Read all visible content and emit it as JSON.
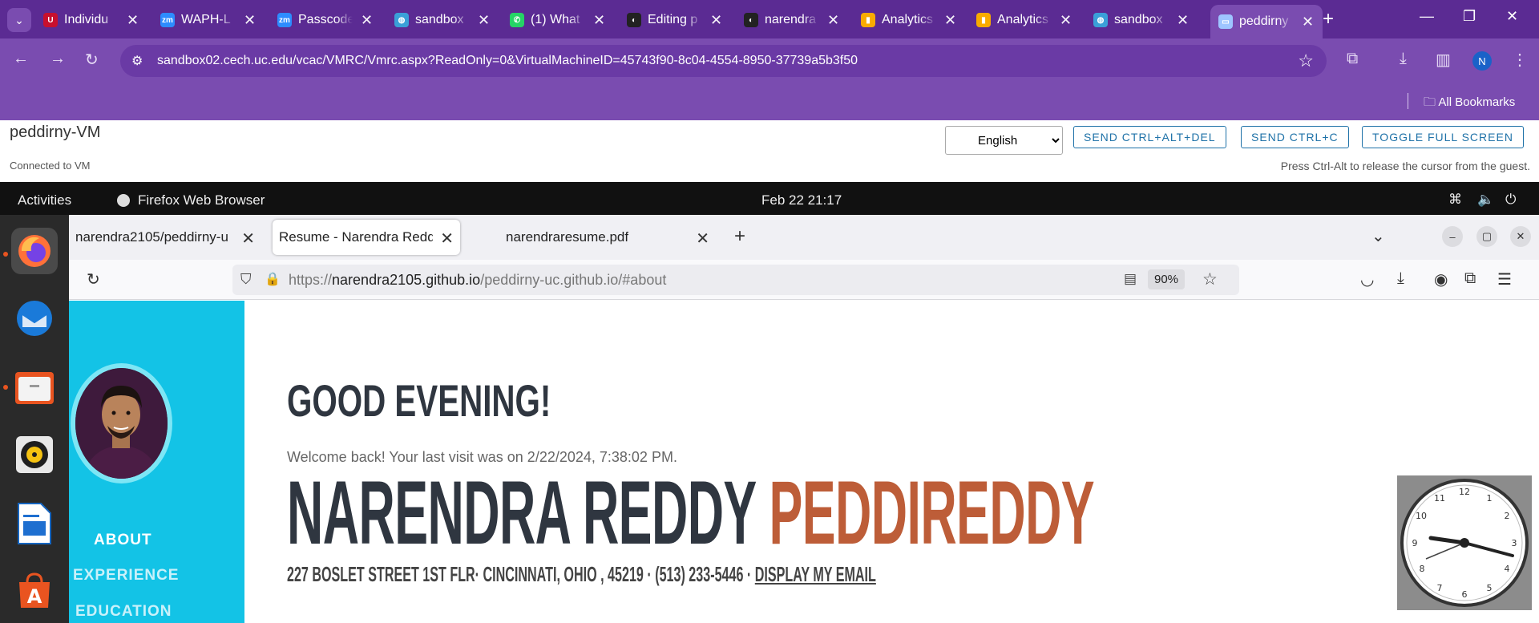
{
  "browser": {
    "tabs": [
      {
        "title": "Individu",
        "favicon": "uc-logo-icon",
        "color": "#c8102e"
      },
      {
        "title": "WAPH-L",
        "favicon": "zoom-icon",
        "color": "#2d8cff"
      },
      {
        "title": "Passcode",
        "favicon": "zoom-icon",
        "color": "#2d8cff"
      },
      {
        "title": "sandbox",
        "favicon": "globe-icon",
        "color": "#3aa0d8"
      },
      {
        "title": "(1) What",
        "favicon": "whatsapp-icon",
        "color": "#25d366"
      },
      {
        "title": "Editing p",
        "favicon": "github-icon",
        "color": "#222222"
      },
      {
        "title": "narendra",
        "favicon": "github-icon",
        "color": "#222222"
      },
      {
        "title": "Analytics",
        "favicon": "analytics-icon",
        "color": "#f9ab00"
      },
      {
        "title": "Analytics",
        "favicon": "analytics-icon",
        "color": "#f9ab00"
      },
      {
        "title": "sandbox",
        "favicon": "globe-icon",
        "color": "#3aa0d8"
      },
      {
        "title": "peddirny",
        "favicon": "monitor-icon",
        "color": "#9ec5ff"
      }
    ],
    "url": "sandbox02.cech.uc.edu/vcac/VMRC/Vmrc.aspx?ReadOnly=0&VirtualMachineID=45743f90-8c04-4554-8950-37739a5b3f50",
    "profile_initial": "N",
    "all_bookmarks": "All Bookmarks"
  },
  "vmrc": {
    "vm_name": "peddirny-VM",
    "status": "Connected to VM",
    "language": "English",
    "btn_ctrl_alt_del": "SEND CTRL+ALT+DEL",
    "btn_ctrl_c": "SEND CTRL+C",
    "btn_fullscreen": "TOGGLE FULL SCREEN",
    "hint": "Press Ctrl-Alt to release the cursor from the guest."
  },
  "gnome": {
    "activities": "Activities",
    "app_name": "Firefox Web Browser",
    "datetime": "Feb 22  21:17"
  },
  "firefox": {
    "tabs": [
      {
        "title": "narendra2105/peddirny-u"
      },
      {
        "title": "Resume - Narendra Reddy Pe"
      },
      {
        "title": "narendraresume.pdf"
      }
    ],
    "url_scheme": "https://",
    "url_domain": "narendra2105.github.io",
    "url_path": "/peddirny-uc.github.io/#about",
    "zoom": "90%"
  },
  "page": {
    "nav": {
      "about": "ABOUT",
      "experience": "EXPERIENCE",
      "education": "EDUCATION"
    },
    "greeting": "GOOD EVENING!",
    "welcome": "Welcome back! Your last visit was on 2/22/2024, 7:38:02 PM.",
    "first_names": "NARENDRA REDDY",
    "last_name": "PEDDIREDDY",
    "address": "227 BOSLET STREET 1ST FLR· CINCINNATI, OHIO , 45219 · (513) 233-5446 · ",
    "email_link": "DISPLAY MY EMAIL",
    "colors": {
      "nav_bg": "#13c3e6",
      "accent": "#bd5d38",
      "heading": "#2f3640"
    }
  }
}
